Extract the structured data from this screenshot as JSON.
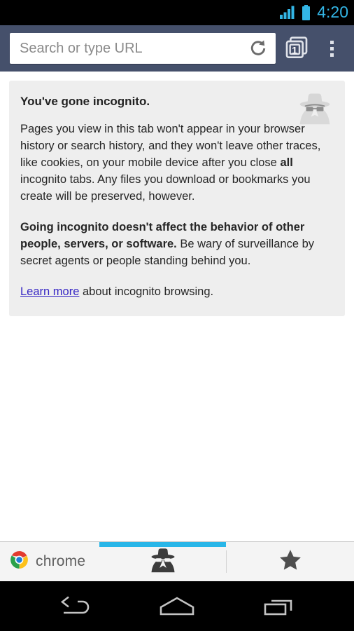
{
  "status_bar": {
    "time": "4:20",
    "signal_icon": "signal-bars-icon",
    "battery_icon": "battery-icon",
    "accent_color": "#33b5e5",
    "background_color": "#000000"
  },
  "toolbar": {
    "background_color": "#45506b",
    "omnibox_placeholder": "Search or type URL",
    "omnibox_value": "",
    "reload_icon": "reload-icon",
    "tab_switcher_icon": "tab-stack-icon",
    "tab_count": "1",
    "menu_icon": "overflow-menu-icon"
  },
  "content": {
    "card": {
      "heading": "You've gone incognito.",
      "watermark_icon": "incognito-spy-icon",
      "paragraph1": {
        "part1": "Pages you view in this tab won't appear in your browser history or search history, and they won't leave other traces, like cookies, on your mobile device after you close ",
        "bold": "all",
        "part2": " incognito tabs. Any files you download or bookmarks you create will be preserved, however."
      },
      "paragraph2": {
        "bold": "Going incognito doesn't affect the behavior of other people, servers, or software.",
        "rest": " Be wary of surveillance by secret agents or people standing behind you."
      },
      "paragraph3": {
        "link": "Learn more",
        "rest": " about incognito browsing."
      },
      "background_color": "#eeeeee",
      "link_color": "#3626c4"
    }
  },
  "bottom_bar": {
    "brand_label": "chrome",
    "brand_icon": "chrome-logo-icon",
    "tabs": [
      {
        "name": "incognito",
        "icon": "incognito-spy-icon",
        "active": true
      },
      {
        "name": "bookmarks",
        "icon": "star-icon",
        "active": false
      }
    ],
    "active_indicator_color": "#29b6e8",
    "background_color": "#f4f4f4"
  },
  "nav_bar": {
    "background_color": "#000000",
    "buttons": [
      {
        "name": "back",
        "icon": "back-arrow-icon"
      },
      {
        "name": "home",
        "icon": "home-icon"
      },
      {
        "name": "recents",
        "icon": "recent-apps-icon"
      }
    ]
  }
}
